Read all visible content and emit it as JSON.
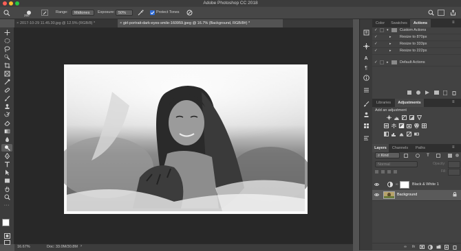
{
  "window": {
    "title": "Adobe Photoshop CC 2018"
  },
  "options_bar": {
    "brush_size": "250",
    "range_label": "Range:",
    "range_value": "Midtones",
    "exposure_label": "Exposure:",
    "exposure_value": "50%",
    "protect_tones_label": "Protect Tones"
  },
  "doc_tabs": [
    {
      "label": "2017-10-29 11.45.30.jpg @ 12.5% (RGB/8) *",
      "active": false
    },
    {
      "label": "girl-portrait-dark-eyes-smile-160959.jpeg @ 16.7% (Background, RGB/8#) *",
      "active": true
    }
  ],
  "status_bar": {
    "zoom": "16.67%",
    "doc": "Doc: 33.0M/30.8M"
  },
  "panels": {
    "top_tabs": [
      "Color",
      "Swatches",
      "Actions"
    ],
    "actions": {
      "set_name": "Custom Actions",
      "items": [
        "Resize to 870px",
        "Resize to 333px",
        "Resize to 222px"
      ],
      "default_set": "Default Actions"
    },
    "mid_tabs": [
      "Libraries",
      "Adjustments"
    ],
    "adjustments_header": "Add an adjustment",
    "layer_tabs": [
      "Layers",
      "Channels",
      "Paths"
    ],
    "layers_filter": {
      "kind": "Kind",
      "blend": "Normal",
      "opacity_label": "Opacity:",
      "fill_label": "Fill:"
    },
    "layers": [
      {
        "name": "Black & White 1",
        "type": "adjustment"
      },
      {
        "name": "Background",
        "type": "image"
      }
    ]
  },
  "colors": {
    "accent": "#2e6bd6",
    "ui_dark": "#282828",
    "panel": "#424242"
  }
}
